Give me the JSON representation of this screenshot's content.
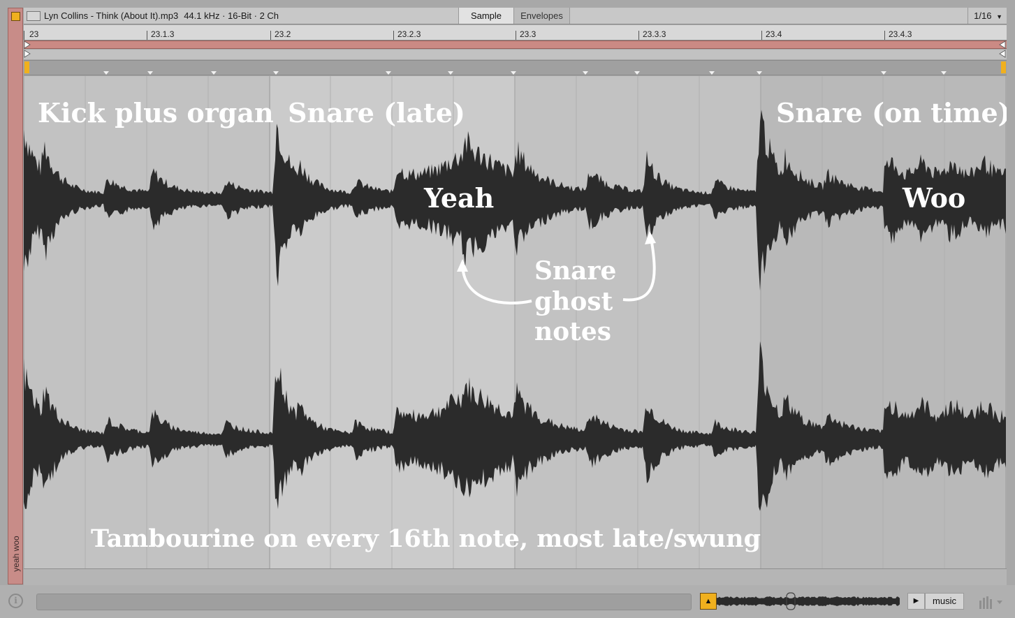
{
  "clip": {
    "name_vertical": "yeah woo",
    "title": "Lyn Collins - Think (About It).mp3",
    "format": "44.1 kHz · 16-Bit · 2 Ch"
  },
  "tabs": {
    "sample": "Sample",
    "envelopes": "Envelopes"
  },
  "grid": {
    "resolution": "1/16",
    "dropdown_glyph": "▼"
  },
  "ruler": {
    "labels": [
      "23",
      "23.1.3",
      "23.2",
      "23.2.3",
      "23.3",
      "23.3.3",
      "23.4",
      "23.4.3"
    ]
  },
  "annotations": {
    "kick": "Kick plus organ",
    "snare_late": "Snare (late)",
    "snare_on_time": "Snare (on time)",
    "yeah": "Yeah",
    "woo": "Woo",
    "ghost_1": "Snare",
    "ghost_2": "ghost",
    "ghost_3": "notes",
    "tambourine": "Tambourine on every 16th note, most late/swung"
  },
  "bottom": {
    "info_glyph": "i",
    "preview_glyph": "▲",
    "play_glyph": "▶",
    "music_label": "music"
  },
  "colors": {
    "waveform": "#2b2b2b",
    "loop_bar": "#cb8a84",
    "clip_color": "#c88c88",
    "accent": "#f0b01e",
    "annotation_text": "#ffffff"
  },
  "icons": [
    "clip-toggle-icon",
    "waveform-icon",
    "info-icon",
    "play-icon",
    "meter-icon"
  ]
}
